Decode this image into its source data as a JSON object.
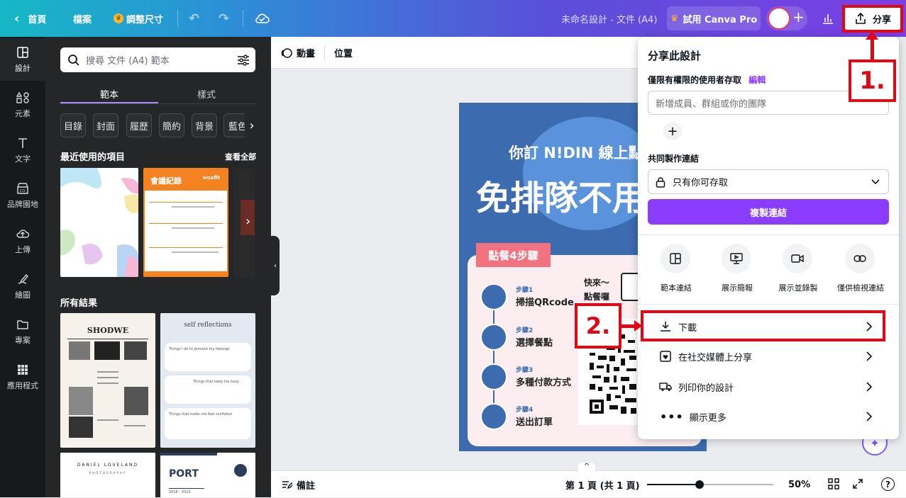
{
  "topbar": {
    "home": "首頁",
    "file": "檔案",
    "resize": "調整尺寸",
    "doc_title": "未命名設計 - 文件 (A4)",
    "try_pro": "試用 Canva Pro",
    "share": "分享",
    "accent": "#8b3dff"
  },
  "rail": {
    "items": [
      {
        "label": "設計",
        "icon": "layout-icon"
      },
      {
        "label": "元素",
        "icon": "shapes-icon"
      },
      {
        "label": "文字",
        "icon": "text-icon"
      },
      {
        "label": "品牌園地",
        "icon": "brand-icon"
      },
      {
        "label": "上傳",
        "icon": "upload-icon"
      },
      {
        "label": "繪圖",
        "icon": "draw-icon"
      },
      {
        "label": "專案",
        "icon": "folder-icon"
      },
      {
        "label": "應用程式",
        "icon": "apps-icon"
      }
    ]
  },
  "panel": {
    "search_placeholder": "搜尋 文件 (A4) 範本",
    "tabs": [
      "範本",
      "樣式"
    ],
    "chips": [
      "目錄",
      "封面",
      "履歷",
      "簡約",
      "背景",
      "藍色"
    ],
    "recent_title": "最近使用的項目",
    "see_all": "查看全部",
    "all_results": "所有結果",
    "thumb_meeting": "會議紀錄",
    "thumb_brand": "woofit",
    "thumb_shodwe": "SHODWE",
    "thumb_self": "self reflections",
    "thumb_self_lines": [
      "Things I do to prevent my feelings",
      "Things that keep me busy",
      "Things that make me feel confident"
    ],
    "thumb_daniel": "DANIEL LOVELAND",
    "thumb_daniel_sub": "PHOTOGRAPHY",
    "thumb_port": "PORT",
    "thumb_port_year": "2016 - 2023"
  },
  "context": {
    "animate": "動畫",
    "position": "位置"
  },
  "poster": {
    "line1": "你訂 N!DIN 線上點",
    "headline": "免排隊不用",
    "steps_title": "點餐4步驟",
    "bubble": "快來～\n點餐囉",
    "steps": [
      {
        "num": "步驟1",
        "text": "掃描QRcode"
      },
      {
        "num": "步驟2",
        "text": "選擇餐點"
      },
      {
        "num": "步驟3",
        "text": "多種付款方式"
      },
      {
        "num": "步驟4",
        "text": "送出訂單"
      }
    ]
  },
  "share_menu": {
    "title": "分享此設計",
    "access_label": "僅限有權限的使用者存取",
    "edit": "編輯",
    "invite_placeholder": "新增成員、群組或你的團隊",
    "collab_label": "共同製作連結",
    "access_select": "只有你可存取",
    "copy_link": "複製連結",
    "quick": [
      "範本連結",
      "展示簡報",
      "展示並錄製",
      "僅供檢視連結"
    ],
    "rows": [
      {
        "label": "下載",
        "icon": "download-icon"
      },
      {
        "label": "在社交媒體上分享",
        "icon": "heart-icon"
      },
      {
        "label": "列印你的設計",
        "icon": "truck-icon"
      },
      {
        "label": "顯示更多",
        "icon": "more-icon"
      }
    ]
  },
  "bottombar": {
    "notes": "備註",
    "page": "第 1 頁 (共 1 頁)",
    "zoom": "50%",
    "zoom_level": 0.5
  },
  "annotations": {
    "step1": "1.",
    "step2": "2."
  }
}
